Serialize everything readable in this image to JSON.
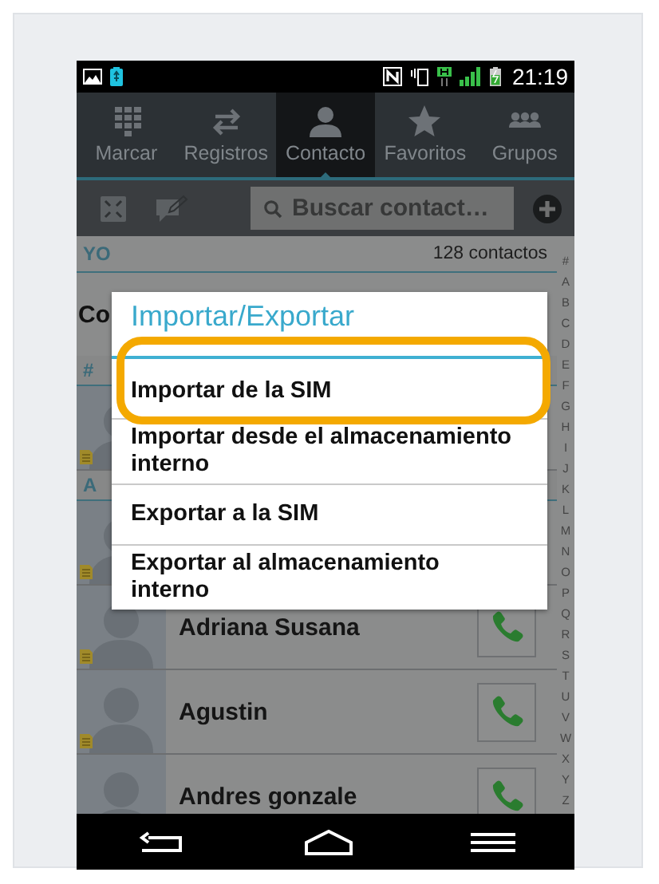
{
  "status_bar": {
    "time": "21:19"
  },
  "tabs": [
    {
      "label": "Marcar",
      "selected": false
    },
    {
      "label": "Registros",
      "selected": false
    },
    {
      "label": "Contacto",
      "selected": true
    },
    {
      "label": "Favoritos",
      "selected": false
    },
    {
      "label": "Grupos",
      "selected": false
    }
  ],
  "toolbar": {
    "search": {
      "placeholder": "Buscar contact…"
    }
  },
  "me_header": {
    "label": "YO",
    "count": "128 contactos"
  },
  "list": [
    {
      "kind": "title",
      "text": "Co"
    },
    {
      "kind": "section",
      "text": "#"
    },
    {
      "kind": "contact"
    },
    {
      "kind": "section",
      "text": "A"
    },
    {
      "kind": "contact"
    },
    {
      "kind": "contact",
      "name": "Adriana Susana"
    },
    {
      "kind": "contact",
      "name": "Agustin"
    },
    {
      "kind": "contact",
      "name": "Andres gonzale"
    }
  ],
  "index_letters": [
    "#",
    "A",
    "B",
    "C",
    "D",
    "E",
    "F",
    "G",
    "H",
    "I",
    "J",
    "K",
    "L",
    "M",
    "N",
    "O",
    "P",
    "Q",
    "R",
    "S",
    "T",
    "U",
    "V",
    "W",
    "X",
    "Y",
    "Z"
  ],
  "dialog": {
    "title": "Importar/Exportar",
    "items": [
      {
        "label": "Importar de la SIM",
        "highlighted": true
      },
      {
        "label": "Importar desde el almacenamiento interno",
        "highlighted": false
      },
      {
        "label": "Exportar a la SIM",
        "highlighted": false
      },
      {
        "label": "Exportar al almacenamiento interno",
        "highlighted": false
      }
    ]
  }
}
